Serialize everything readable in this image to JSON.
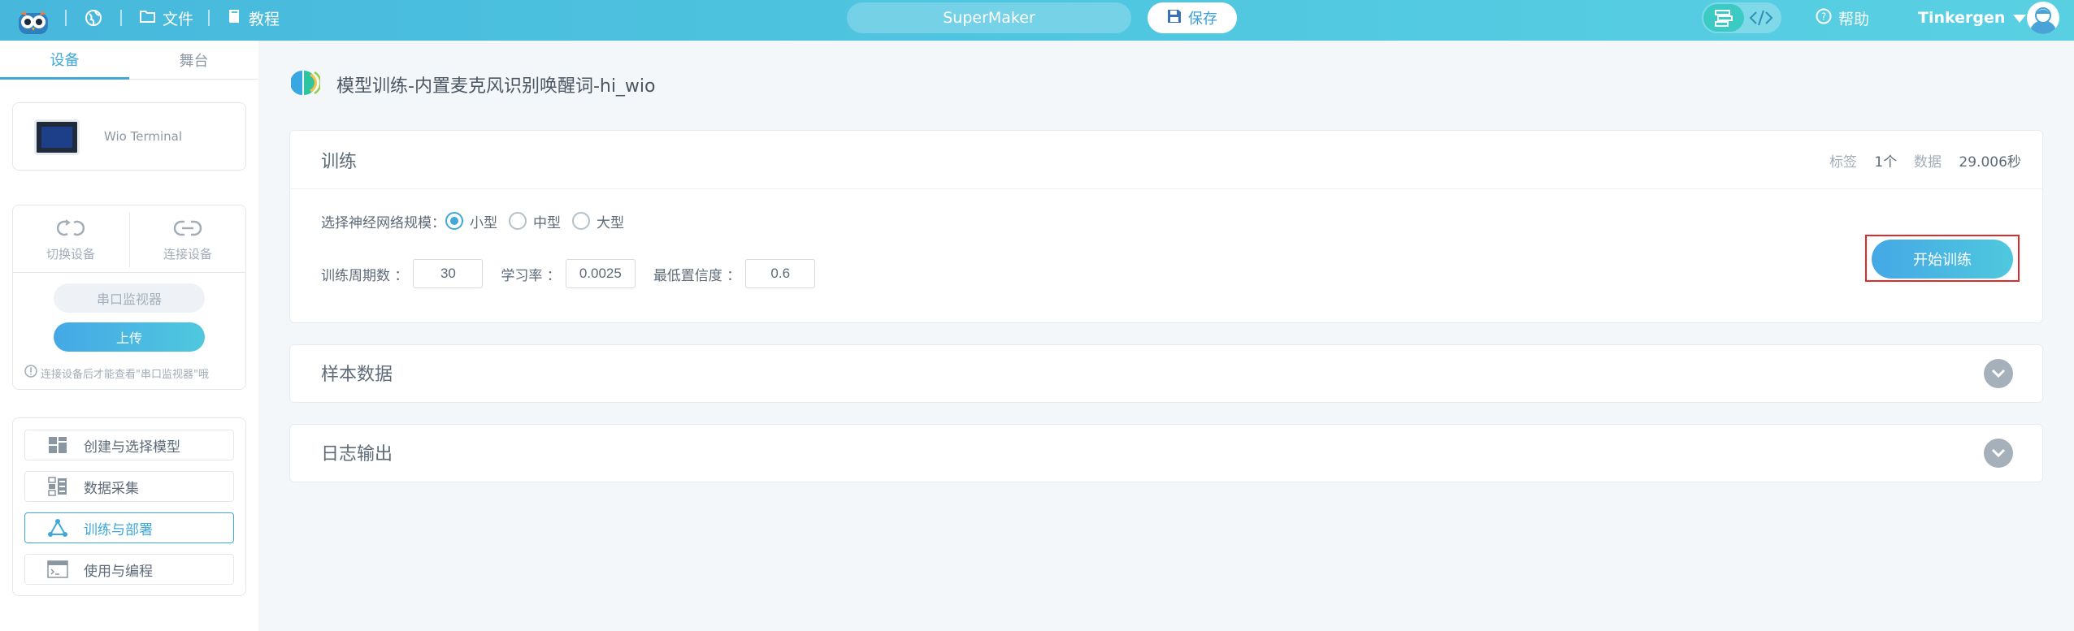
{
  "topbar": {
    "file_label": "文件",
    "tutorial_label": "教程",
    "project_name": "SuperMaker",
    "save_label": "保存",
    "help_label": "帮助",
    "username": "Tinkergen"
  },
  "sidebar": {
    "tabs": [
      "设备",
      "舞台"
    ],
    "device_name": "Wio Terminal",
    "switch_device": "切换设备",
    "connect_device": "连接设备",
    "serial_monitor": "串口监视器",
    "upload": "上传",
    "hint": "连接设备后才能查看\"串口监视器\"哦",
    "nav": [
      {
        "label": "创建与选择模型",
        "icon": "model-grid-icon"
      },
      {
        "label": "数据采集",
        "icon": "data-collect-icon"
      },
      {
        "label": "训练与部署",
        "icon": "network-train-icon"
      },
      {
        "label": "使用与编程",
        "icon": "terminal-icon"
      }
    ]
  },
  "main": {
    "page_title": "模型训练-内置麦克风识别唤醒词-hi_wio",
    "train": {
      "title": "训练",
      "labels_key": "标签",
      "labels_value": "1个",
      "data_key": "数据",
      "data_value": "29.006秒",
      "network_size_label": "选择神经网络规模：",
      "sizes": [
        "小型",
        "中型",
        "大型"
      ],
      "selected_size": "小型",
      "epochs_label": "训练周期数 ：",
      "epochs_value": "30",
      "lr_label": "学习率 ：",
      "lr_value": "0.0025",
      "confidence_label": "最低置信度 ：",
      "confidence_value": "0.6",
      "start_label": "开始训练"
    },
    "sample_data_title": "样本数据",
    "log_output_title": "日志输出"
  },
  "colors": {
    "accent": "#3fa8d8",
    "topbar_gradient": [
      "#47b8dc",
      "#59d0e2"
    ],
    "highlight_border": "#e02a2a"
  }
}
